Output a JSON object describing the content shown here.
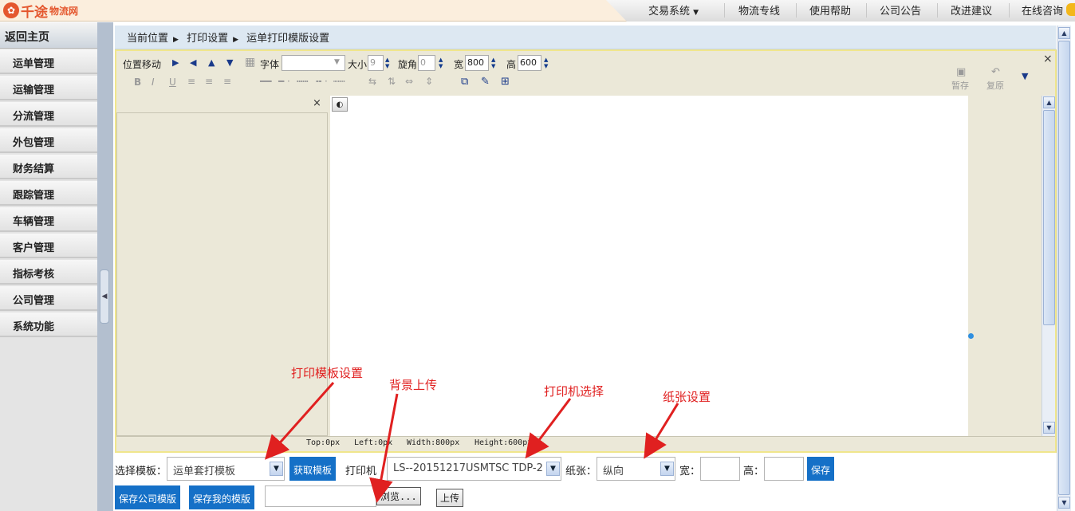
{
  "header": {
    "logo_text": "千途",
    "logo_sub": "物流网",
    "nav": [
      "交易系统",
      "物流专线",
      "使用帮助",
      "公司公告",
      "改进建议",
      "在线咨询"
    ],
    "nav_dropdown_icon": "caret-down"
  },
  "sidebar": {
    "home": "返回主页",
    "items": [
      "运单管理",
      "运输管理",
      "分流管理",
      "外包管理",
      "财务结算",
      "跟踪管理",
      "车辆管理",
      "客户管理",
      "指标考核",
      "公司管理",
      "系统功能"
    ]
  },
  "breadcrumb": {
    "items": [
      "当前位置",
      "打印设置",
      "运单打印模版设置"
    ]
  },
  "toolbar": {
    "position_move": "位置移动",
    "font_label": "字体",
    "font_value": "",
    "size_label": "大小",
    "size_value": "9",
    "rotate_label": "旋角",
    "rotate_value": "0",
    "width_label": "宽",
    "width_value": "800",
    "height_label": "高",
    "height_value": "600",
    "save_temp": "暂存",
    "restore": "复原",
    "close": "×"
  },
  "panel": {
    "close": "×"
  },
  "status": {
    "top": "Top:0px",
    "left": "Left:0px",
    "width": "Width:800px",
    "height": "Height:600px"
  },
  "form": {
    "template_label": "选择模板：",
    "template_value": "运单套打模板",
    "fetch_button": "获取模板",
    "printer_label": "打印机",
    "printer_value": "LS--20151217USMTSC TDP-2",
    "paper_label": "纸张：",
    "paper_value": "纵向",
    "width_label": "宽：",
    "width_value": "",
    "height_label": "高：",
    "height_value": "",
    "save_button": "保存",
    "save_company_button": "保存公司模版",
    "save_mine_button": "保存我的模版",
    "browse_button": "浏览...",
    "upload_button": "上传"
  },
  "annotations": [
    "打印模板设置",
    "背景上传",
    "打印机选择",
    "纸张设置"
  ],
  "colors": {
    "accent_blue": "#1570c7",
    "annotation_red": "#e02020",
    "brand_orange": "#e4572e"
  }
}
